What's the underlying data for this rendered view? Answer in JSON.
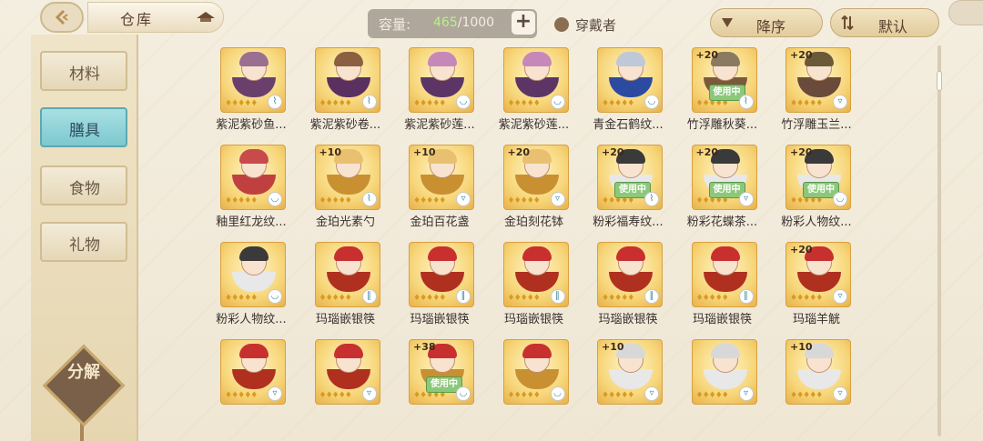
{
  "header": {
    "title": "仓库",
    "capacity_label": "容量:",
    "capacity_used": "465",
    "capacity_total": "/1000",
    "add_label": "+",
    "wearer_label": "穿戴者",
    "sort_label": "降序",
    "default_label": "默认"
  },
  "sidebar": {
    "tabs": [
      {
        "label": "材料",
        "active": false
      },
      {
        "label": "膳具",
        "active": true
      },
      {
        "label": "食物",
        "active": false
      },
      {
        "label": "礼物",
        "active": false
      }
    ],
    "decompose_label": "分解"
  },
  "items": [
    {
      "name": "紫泥紫砂鱼...",
      "plus": "",
      "in_use": false,
      "hair": "#9a6f8f",
      "bowl": "#6a3f6c",
      "icon": "spoon-icon"
    },
    {
      "name": "紫泥紫砂卷...",
      "plus": "",
      "in_use": false,
      "hair": "#8a6040",
      "bowl": "#5a3060",
      "icon": "spoon-icon"
    },
    {
      "name": "紫泥紫砂莲...",
      "plus": "",
      "in_use": false,
      "hair": "#c688b8",
      "bowl": "#5c3566",
      "icon": "bowl-icon"
    },
    {
      "name": "紫泥紫砂莲...",
      "plus": "",
      "in_use": false,
      "hair": "#c688b8",
      "bowl": "#5c3566",
      "icon": "bowl-icon"
    },
    {
      "name": "青金石鹤纹...",
      "plus": "",
      "in_use": false,
      "hair": "#bfc8d8",
      "bowl": "#2c4aa0",
      "icon": "bowl-icon"
    },
    {
      "name": "竹浮雕秋葵...",
      "plus": "+20",
      "in_use": true,
      "hair": "#8a7a60",
      "bowl": "#7a5a3a",
      "icon": "spoon-icon"
    },
    {
      "name": "竹浮雕玉兰...",
      "plus": "+20",
      "in_use": false,
      "hair": "#6a5a3a",
      "bowl": "#6a4a3a",
      "icon": "cup-icon"
    },
    {
      "name": "釉里红龙纹...",
      "plus": "",
      "in_use": false,
      "hair": "#c84a4a",
      "bowl": "#c04040",
      "icon": "bowl-icon"
    },
    {
      "name": "金珀光素勺",
      "plus": "+10",
      "in_use": false,
      "hair": "#e8c070",
      "bowl": "#c89030",
      "icon": "spoon-icon"
    },
    {
      "name": "金珀百花盏",
      "plus": "+10",
      "in_use": false,
      "hair": "#e8c070",
      "bowl": "#c89030",
      "icon": "cup-icon"
    },
    {
      "name": "金珀刻花钵",
      "plus": "+20",
      "in_use": false,
      "hair": "#e8c070",
      "bowl": "#c89030",
      "icon": "cup-icon"
    },
    {
      "name": "粉彩福寿纹...",
      "plus": "+20",
      "in_use": true,
      "hair": "#3a3a3a",
      "bowl": "#e8e8e8",
      "icon": "spoon-icon"
    },
    {
      "name": "粉彩花蝶茶...",
      "plus": "+20",
      "in_use": true,
      "hair": "#3a3a3a",
      "bowl": "#e8e8e8",
      "icon": "cup-icon"
    },
    {
      "name": "粉彩人物纹...",
      "plus": "+20",
      "in_use": true,
      "hair": "#3a3a3a",
      "bowl": "#e8e8e8",
      "icon": "bowl-icon"
    },
    {
      "name": "粉彩人物纹...",
      "plus": "",
      "in_use": false,
      "hair": "#3a3a3a",
      "bowl": "#e8e8e8",
      "icon": "bowl-icon"
    },
    {
      "name": "玛瑙嵌银筷",
      "plus": "",
      "in_use": false,
      "hair": "#c83030",
      "bowl": "#b03020",
      "icon": "chopsticks-icon"
    },
    {
      "name": "玛瑙嵌银筷",
      "plus": "",
      "in_use": false,
      "hair": "#c83030",
      "bowl": "#b03020",
      "icon": "chopsticks-icon"
    },
    {
      "name": "玛瑙嵌银筷",
      "plus": "",
      "in_use": false,
      "hair": "#c83030",
      "bowl": "#b03020",
      "icon": "chopsticks-icon"
    },
    {
      "name": "玛瑙嵌银筷",
      "plus": "",
      "in_use": false,
      "hair": "#c83030",
      "bowl": "#b03020",
      "icon": "chopsticks-icon"
    },
    {
      "name": "玛瑙嵌银筷",
      "plus": "",
      "in_use": false,
      "hair": "#c83030",
      "bowl": "#b03020",
      "icon": "chopsticks-icon"
    },
    {
      "name": "玛瑙羊觥",
      "plus": "+20",
      "in_use": false,
      "hair": "#c83030",
      "bowl": "#b03020",
      "icon": "cup-icon"
    },
    {
      "name": "",
      "plus": "",
      "in_use": false,
      "hair": "#c83030",
      "bowl": "#b03020",
      "icon": "cup-icon"
    },
    {
      "name": "",
      "plus": "",
      "in_use": false,
      "hair": "#c83030",
      "bowl": "#b03020",
      "icon": "cup-icon"
    },
    {
      "name": "",
      "plus": "+38",
      "in_use": true,
      "hair": "#c83030",
      "bowl": "#c89030",
      "icon": "bowl-icon"
    },
    {
      "name": "",
      "plus": "",
      "in_use": false,
      "hair": "#c83030",
      "bowl": "#c89030",
      "icon": "bowl-icon"
    },
    {
      "name": "",
      "plus": "+10",
      "in_use": false,
      "hair": "#d8d8d8",
      "bowl": "#e8e8e8",
      "icon": "cup-icon"
    },
    {
      "name": "",
      "plus": "",
      "in_use": false,
      "hair": "#d8d8d8",
      "bowl": "#e8e8e8",
      "icon": "cup-icon"
    },
    {
      "name": "",
      "plus": "+10",
      "in_use": false,
      "hair": "#d8d8d8",
      "bowl": "#e8e8e8",
      "icon": "cup-icon"
    }
  ],
  "inuse_label": "使用中",
  "colors": {
    "accent_tab": "#7cc8ce",
    "card_gold": "#f7d67a",
    "capacity_used": "#b8f08a"
  }
}
